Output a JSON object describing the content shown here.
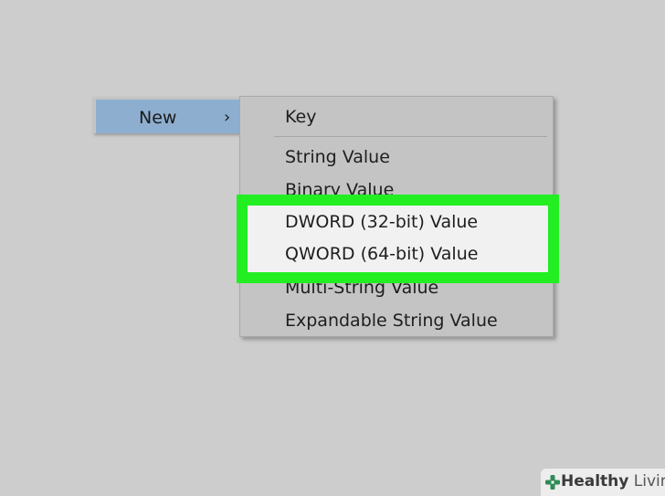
{
  "context_menu": {
    "parent_item_label": "New",
    "chevron": "›"
  },
  "submenu": {
    "items": [
      {
        "label": "Key"
      },
      {
        "label": "String Value"
      },
      {
        "label": "Binary Value"
      },
      {
        "label": "DWORD (32-bit) Value"
      },
      {
        "label": "QWORD (64-bit) Value"
      },
      {
        "label": "Multi-String Value"
      },
      {
        "label": "Expandable String Value"
      }
    ]
  },
  "highlight": {
    "color": "#22ee22"
  },
  "watermark": {
    "brand_bold": "Healthy",
    "brand_light": " Living",
    "icon": "plus-cross-icon",
    "icon_color": "#2e8b57"
  }
}
